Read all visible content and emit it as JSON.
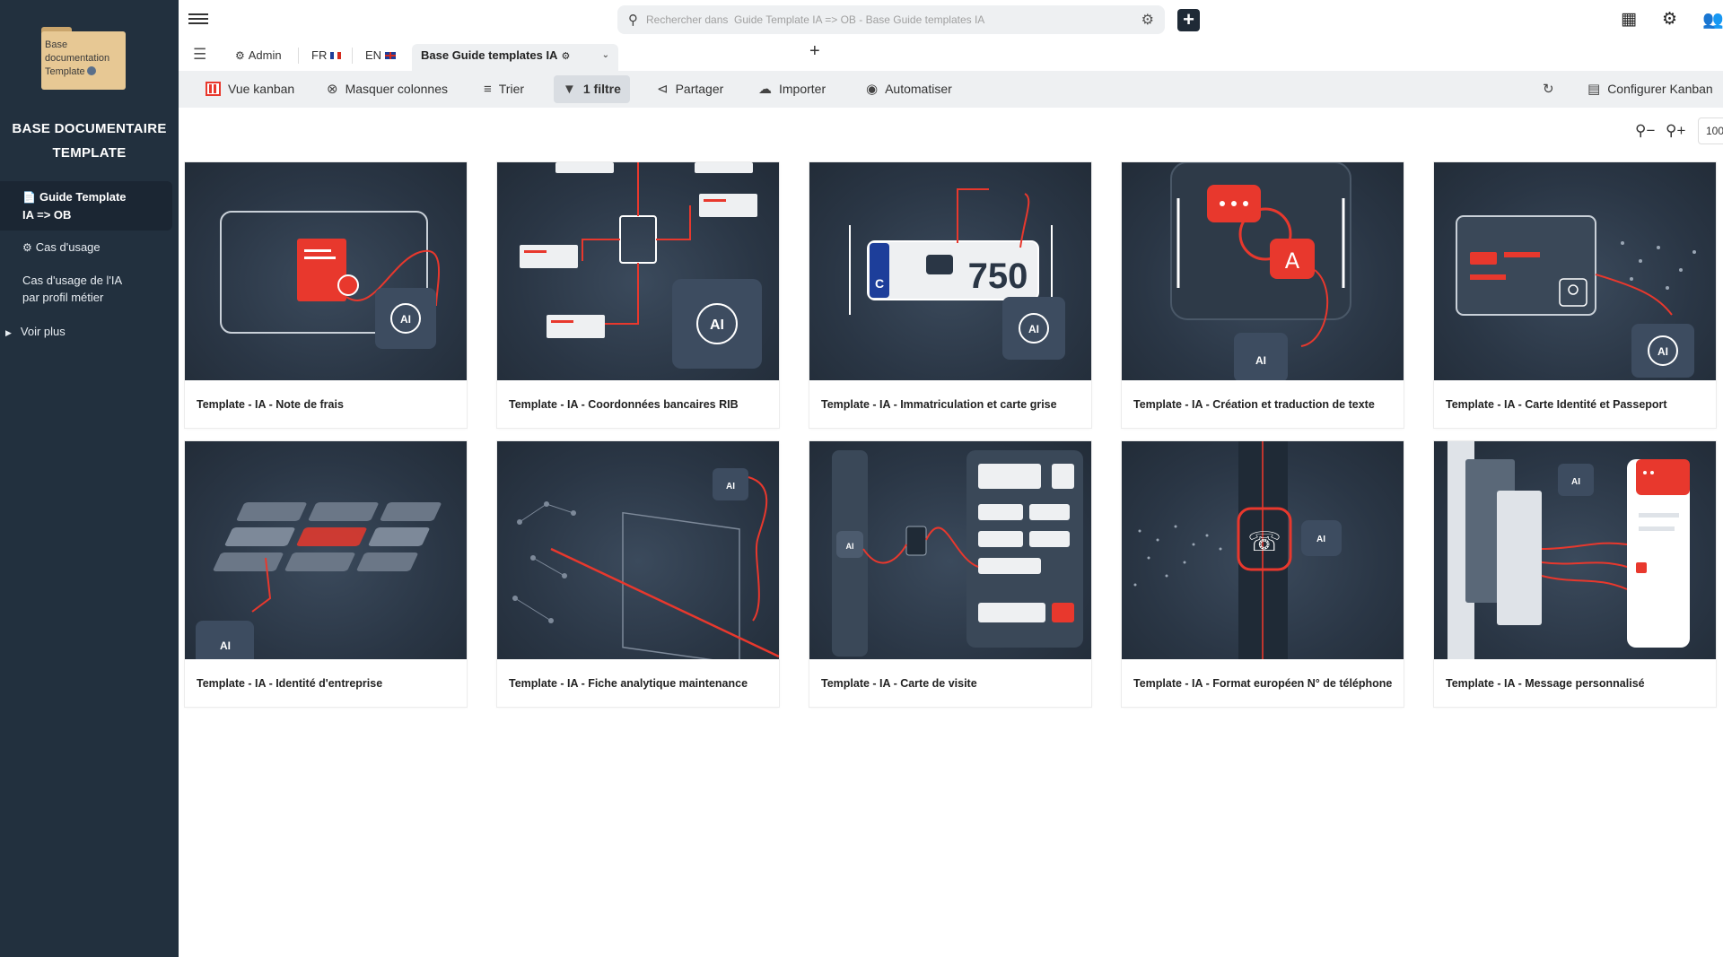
{
  "sidebar": {
    "logo_lines": [
      "Base",
      "documentation",
      "Template"
    ],
    "base_title_line1": "BASE DOCUMENTAIRE",
    "base_title_line2": "TEMPLATE",
    "items": [
      {
        "label_line1": "Guide Template",
        "label_line2": "IA => OB",
        "icon": "document-icon"
      },
      {
        "label": "Cas d'usage",
        "icon": "gear-icon"
      },
      {
        "label_line1": "Cas d'usage de l'IA",
        "label_line2": "par profil métier"
      },
      {
        "label": "Voir plus",
        "icon": "caret-right-icon"
      }
    ]
  },
  "search": {
    "placeholder": "Rechercher dans  Guide Template IA => OB - Base Guide templates IA"
  },
  "tabs": [
    {
      "label": "Admin",
      "icon": "gear-icon"
    },
    {
      "label": "FR",
      "flag": "fr"
    },
    {
      "label": "EN",
      "flag": "en"
    },
    {
      "label": "Base Guide templates IA",
      "active": true
    }
  ],
  "toolbar": {
    "kanban": "Vue kanban",
    "masquer": "Masquer colonnes",
    "trier": "Trier",
    "filtre": "1 filtre",
    "partager": "Partager",
    "importer": "Importer",
    "automatiser": "Automatiser",
    "configurer": "Configurer Kanban"
  },
  "zoom": {
    "level": "100"
  },
  "cards": [
    {
      "title": "Template - IA - Note de frais"
    },
    {
      "title": "Template - IA - Coordonnées bancaires RIB"
    },
    {
      "title": "Template - IA - Immatriculation et carte grise"
    },
    {
      "title": "Template - IA - Création et traduction de texte"
    },
    {
      "title": "Template - IA - Carte Identité et Passeport"
    },
    {
      "title": "Template - IA - Identité d'entreprise"
    },
    {
      "title": "Template - IA - Fiche analytique maintenance"
    },
    {
      "title": "Template - IA - Carte de visite"
    },
    {
      "title": "Template - IA - Format européen N° de téléphone"
    },
    {
      "title": "Template - IA - Message personnalisé"
    }
  ],
  "colors": {
    "sidebar_bg": "#22303e",
    "accent_red": "#e8382d",
    "toolbar_bg": "#eef0f2"
  }
}
